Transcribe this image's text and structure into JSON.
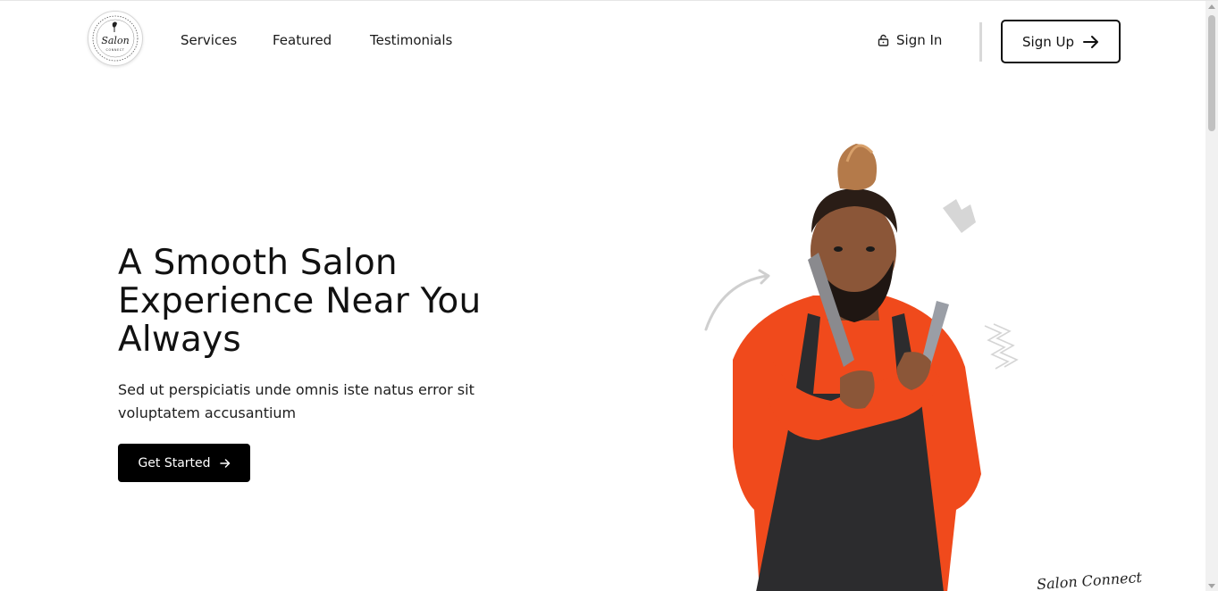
{
  "brand": {
    "logo_icon": "salon-connect-logo",
    "logo_text": "Salon",
    "logo_subtext": "CONNECT"
  },
  "nav": {
    "items": [
      {
        "label": "Services"
      },
      {
        "label": "Featured"
      },
      {
        "label": "Testimonials"
      }
    ]
  },
  "auth": {
    "signin_label": "Sign In",
    "signin_icon": "lock-icon",
    "signup_label": "Sign Up",
    "signup_icon": "arrow-right-icon"
  },
  "hero": {
    "title": "A Smooth Salon Experience Near You Always",
    "subtitle": "Sed ut perspiciatis unde omnis iste natus error sit voluptatem accusantium",
    "cta_label": "Get Started",
    "cta_icon": "arrow-right-icon",
    "image_icon": "barber-portrait-image",
    "signature": "Salon Connect"
  },
  "colors": {
    "text": "#111111",
    "cta_bg": "#000000",
    "cta_text": "#ffffff",
    "shirt": "#f04a1c",
    "apron": "#2c2c2e",
    "skin": "#8b5638",
    "doodle": "#cfcfcf"
  }
}
